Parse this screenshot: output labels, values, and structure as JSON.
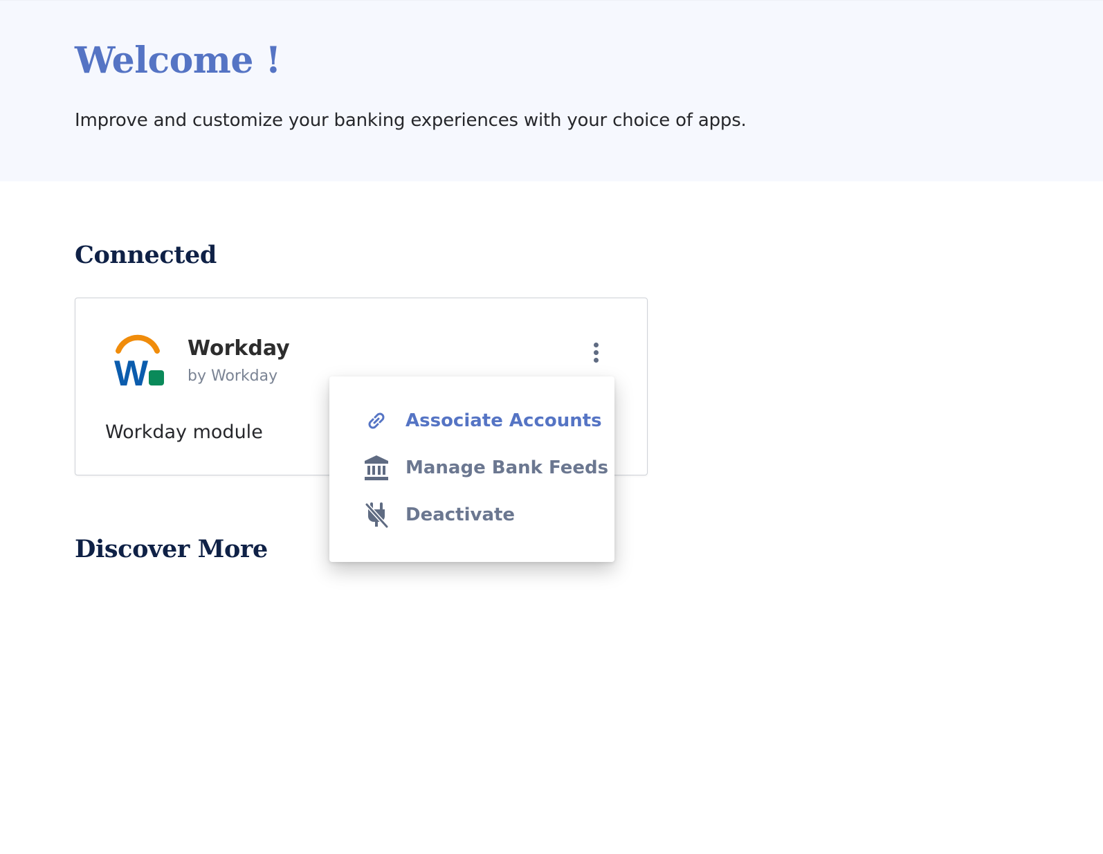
{
  "hero": {
    "title": "Welcome !",
    "subtitle": "Improve and customize your banking experiences with your choice of apps."
  },
  "sections": {
    "connected_title": "Connected",
    "discover_title": "Discover More"
  },
  "app_card": {
    "name": "Workday",
    "vendor": "by Workday",
    "description": "Workday module",
    "logo_icon": "workday-logo",
    "menu_icon": "kebab-menu-icon"
  },
  "menu": {
    "items": [
      {
        "label": "Associate Accounts",
        "icon": "link-icon"
      },
      {
        "label": "Manage Bank Feeds",
        "icon": "bank-icon"
      },
      {
        "label": "Deactivate",
        "icon": "plug-off-icon"
      }
    ]
  },
  "colors": {
    "accent": "#5574c4",
    "heading": "#0f2146",
    "muted": "#6b7790",
    "hero_bg": "#f6f8fe",
    "logo_orange": "#f08c0b",
    "logo_blue": "#0b5cad",
    "logo_green": "#0a8a5a"
  }
}
